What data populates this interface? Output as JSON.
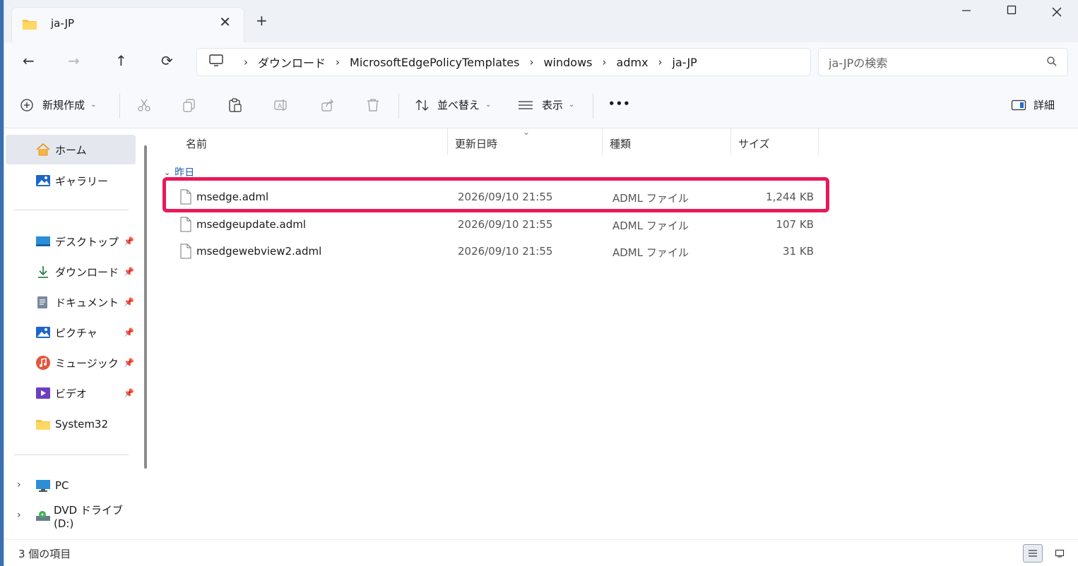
{
  "window": {
    "tab_title": "ja-JP",
    "new_tab": "+",
    "close_tab": "✕"
  },
  "nav": {
    "back": "←",
    "forward": "→",
    "up": "↑",
    "refresh": "⟳"
  },
  "breadcrumb": [
    "ダウンロード",
    "MicrosoftEdgePolicyTemplates",
    "windows",
    "admx",
    "ja-JP"
  ],
  "search": {
    "placeholder": "ja-JPの検索"
  },
  "toolbar": {
    "new_label": "新規作成",
    "sort_label": "並べ替え",
    "view_label": "表示",
    "more_label": "•••",
    "details_label": "詳細"
  },
  "sidebar": {
    "home": "ホーム",
    "gallery": "ギャラリー",
    "pinned": [
      {
        "label": "デスクトップ",
        "icon": "desktop-icon"
      },
      {
        "label": "ダウンロード",
        "icon": "download-icon"
      },
      {
        "label": "ドキュメント",
        "icon": "document-icon"
      },
      {
        "label": "ピクチャ",
        "icon": "picture-icon"
      },
      {
        "label": "ミュージック",
        "icon": "music-icon"
      },
      {
        "label": "ビデオ",
        "icon": "video-icon"
      }
    ],
    "system32": "System32",
    "pc": "PC",
    "dvd": "DVD ドライブ (D:)"
  },
  "columns": {
    "name": "名前",
    "date": "更新日時",
    "type": "種類",
    "size": "サイズ"
  },
  "group": {
    "label": "昨日"
  },
  "files": [
    {
      "name": "msedge.adml",
      "date": "2026/09/10 21:55",
      "type": "ADML ファイル",
      "size": "1,244 KB"
    },
    {
      "name": "msedgeupdate.adml",
      "date": "2026/09/10 21:55",
      "type": "ADML ファイル",
      "size": "107 KB"
    },
    {
      "name": "msedgewebview2.adml",
      "date": "2026/09/10 21:55",
      "type": "ADML ファイル",
      "size": "31 KB"
    }
  ],
  "status": {
    "item_count": "3 個の項目"
  },
  "colors": {
    "highlight": "#e8195a",
    "group_header": "#1b5fa8",
    "accent": "#0067c0"
  }
}
